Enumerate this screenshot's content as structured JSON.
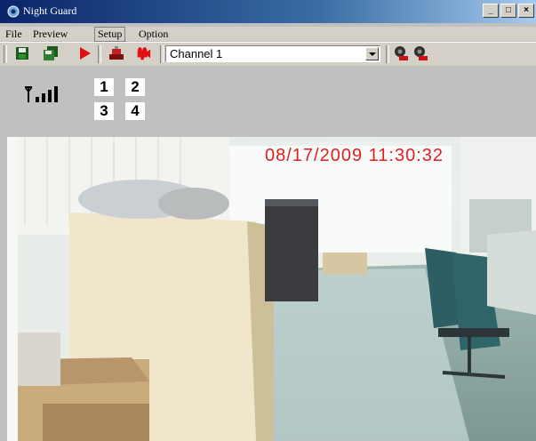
{
  "window": {
    "title": "Night Guard",
    "minimize": "_",
    "maximize": "□",
    "close": "×"
  },
  "menu": {
    "items": [
      "File",
      "Preview",
      "Setup",
      "Option"
    ]
  },
  "toolbar": {
    "channel_select": {
      "selected": "Channel 1"
    },
    "buttons": [
      "save-icon",
      "multi-save-icon",
      "play-icon",
      "record-icon",
      "camera-icon",
      "alarm-on-icon",
      "alarm-off-icon"
    ]
  },
  "status": {
    "signal_icon": "signal-strength-icon",
    "channels": [
      "1",
      "2",
      "3",
      "4"
    ]
  },
  "video": {
    "timestamp": "08/17/2009 11:30:32"
  }
}
